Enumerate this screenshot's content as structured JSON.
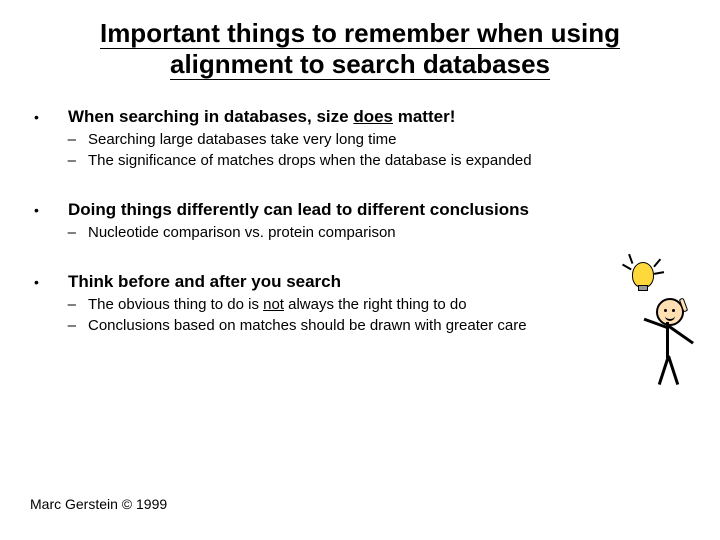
{
  "title_line1": "Important things to remember when using",
  "title_line2": "alignment to search databases",
  "bullets": [
    {
      "prefix": "When searching in databases, size ",
      "emph": "does",
      "suffix": " matter!",
      "sub": [
        "Searching large databases take very long time",
        "The significance of matches drops when the database is expanded"
      ]
    },
    {
      "prefix": "Doing things differently can lead to different conclusions",
      "emph": "",
      "suffix": "",
      "sub": [
        "Nucleotide comparison vs. protein comparison"
      ]
    },
    {
      "prefix": "Think before and after you search",
      "emph": "",
      "suffix": "",
      "sub": [
        {
          "pre": "The obvious thing to do is ",
          "emph": "not",
          "post": " always the right thing to do"
        },
        "Conclusions based on matches should be drawn with greater care"
      ]
    }
  ],
  "footer": "Marc Gerstein © 1999",
  "bullet_char": "•",
  "dash_char": "–"
}
